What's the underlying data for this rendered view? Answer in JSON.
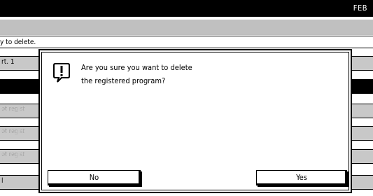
{
  "top_bar": {
    "date_text": "FEB"
  },
  "list": {
    "hint": "y to delete.",
    "items": [
      {
        "label": "rt. 1",
        "state": "normal"
      },
      {
        "label": "",
        "state": "selected"
      },
      {
        "label": "ot regist",
        "state": "ghost"
      },
      {
        "label": "ot regist",
        "state": "ghost"
      },
      {
        "label": "ot regist",
        "state": "ghost"
      },
      {
        "label": "l",
        "state": "normal"
      }
    ]
  },
  "dialog": {
    "icon": "warning-icon",
    "message_line1": "Are you sure you want to delete",
    "message_line2": "the registered program?",
    "no_label": "No",
    "yes_label": "Yes"
  },
  "colors": {
    "background": "#ffffff",
    "ink": "#000000",
    "dither": "#d9d9d9"
  }
}
